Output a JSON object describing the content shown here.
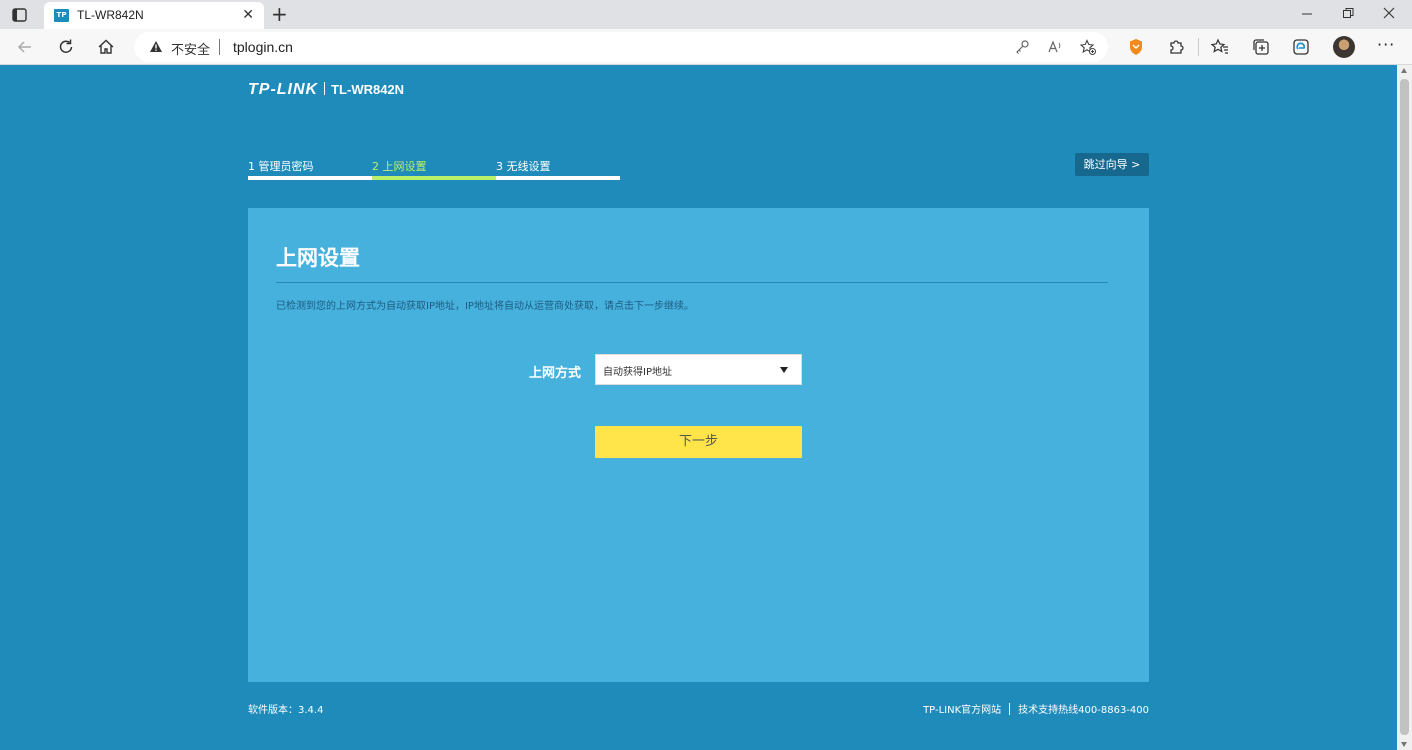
{
  "browser": {
    "tab_title": "TL-WR842N",
    "tab_favicon": "TP",
    "security_label": "不安全",
    "url": "tplogin.cn",
    "new_tab": "+",
    "close_tab": "✕",
    "more": "···"
  },
  "header": {
    "brand": "TP-LINK",
    "model": "TL-WR842N"
  },
  "steps": [
    {
      "label": "1 管理员密码",
      "active": false
    },
    {
      "label": "2 上网设置",
      "active": true
    },
    {
      "label": "3 无线设置",
      "active": false
    }
  ],
  "skip_button": "跳过向导 >",
  "panel": {
    "title": "上网设置",
    "description": "已检测到您的上网方式为自动获取IP地址，IP地址将自动从运营商处获取，请点击下一步继续。",
    "field_label": "上网方式",
    "select_value": "自动获得IP地址",
    "next_button": "下一步"
  },
  "footer": {
    "version": "软件版本：3.4.4",
    "official_site": "TP-LINK官方网站",
    "hotline": "技术支持热线400-8863-400"
  },
  "colors": {
    "page_bg": "#1f8bbb",
    "panel_bg": "#47b1de",
    "step_active": "#b9f06a",
    "next_button": "#ffe54a"
  },
  "icons": [
    "sidebar-toggle-icon",
    "back-arrow-icon",
    "refresh-icon",
    "home-icon",
    "warning-icon",
    "key-icon",
    "read-aloud-icon",
    "add-favorite-icon",
    "brave-shield-icon",
    "extensions-icon",
    "favorites-icon",
    "collections-icon",
    "edge-icon",
    "avatar",
    "more-icon",
    "minimize-icon",
    "maximize-icon",
    "close-icon"
  ]
}
